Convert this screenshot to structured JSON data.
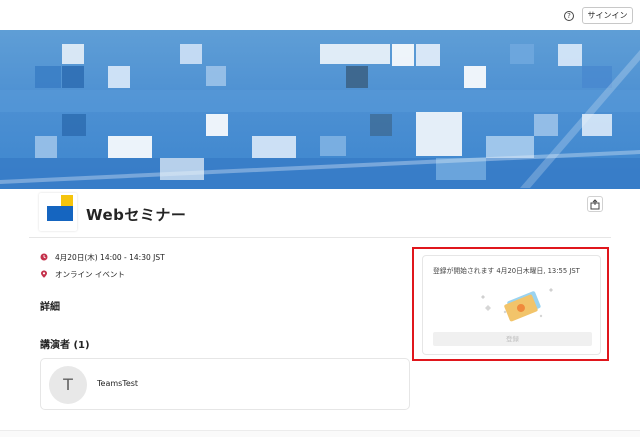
{
  "header": {
    "help_icon": "question-circle-icon",
    "signin_label": "サインイン"
  },
  "event": {
    "title": "Webセミナー",
    "datetime": "4月20日(木) 14:00 - 14:30 JST",
    "location": "オンライン イベント",
    "details_heading": "詳細",
    "speakers_heading": "講演者 (1)",
    "speakers": [
      {
        "initial": "T",
        "name": "TeamsTest"
      }
    ]
  },
  "registration": {
    "opens_text": "登録が開始されます 4月20日木曜日, 13:55 JST",
    "register_label": "登録"
  },
  "colors": {
    "accent": "#e0161c",
    "logo_yellow": "#f5c40c",
    "logo_blue": "#1565c0"
  }
}
